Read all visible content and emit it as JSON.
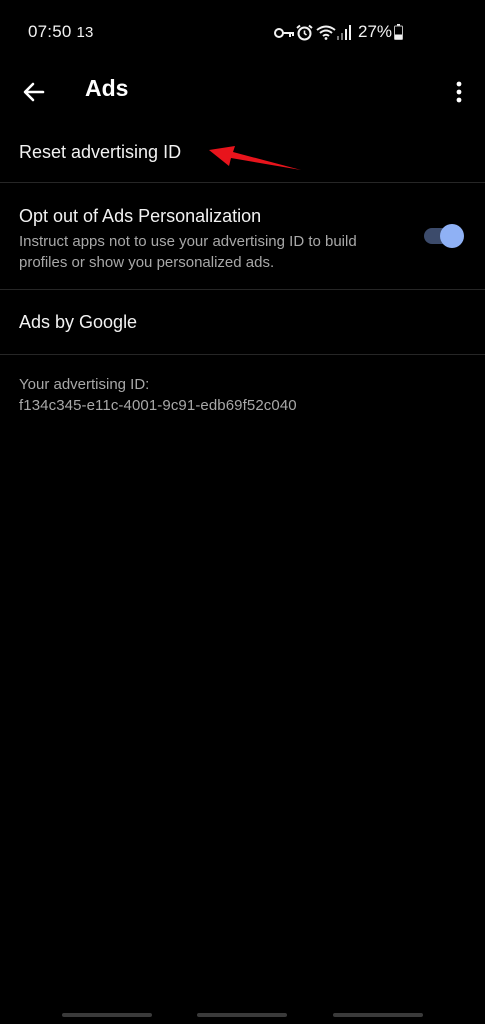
{
  "status_bar": {
    "time": "07:50",
    "notification": "13",
    "battery_percent": "27%",
    "icons": [
      "vpn-key-icon",
      "alarm-icon",
      "wifi-icon",
      "cell-signal-icon",
      "battery-icon"
    ]
  },
  "app_bar": {
    "title": "Ads",
    "back_icon": "arrow-left-icon",
    "more_icon": "more-vert-icon"
  },
  "settings": {
    "reset_id": {
      "title": "Reset advertising ID"
    },
    "opt_out": {
      "title": "Opt out of Ads Personalization",
      "summary": "Instruct apps not to use your advertising ID to build profiles or show you personalized ads.",
      "toggle_on": true
    },
    "ads_by_google": {
      "title": "Ads by Google"
    }
  },
  "advertising_id": {
    "label": "Your advertising ID:",
    "value": "f134c345-e11c-4001-9c91-edb69f52c040"
  },
  "annotation": {
    "arrow_color": "#e8141c",
    "points_to": "Reset advertising ID"
  },
  "colors": {
    "background": "#000000",
    "toggle_thumb": "#8fb1f5",
    "toggle_track": "#3c4b6b",
    "secondary_text": "#a8a8a8"
  }
}
